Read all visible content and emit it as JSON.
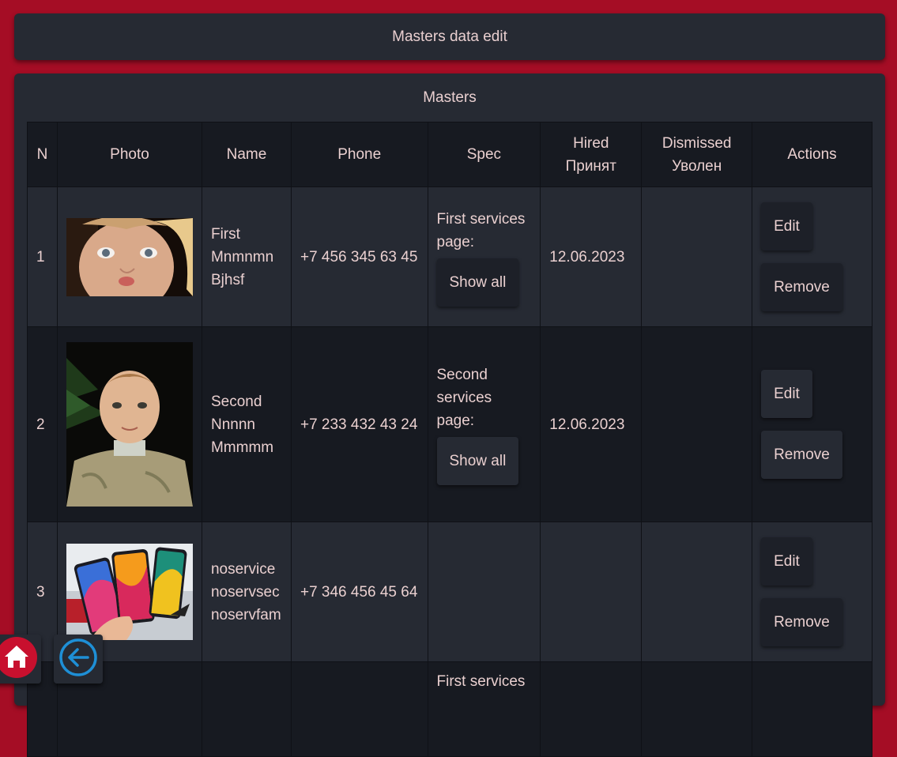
{
  "header": {
    "title": "Masters data edit"
  },
  "section": {
    "title": "Masters"
  },
  "table": {
    "columns": {
      "n": "N",
      "photo": "Photo",
      "name": "Name",
      "phone": "Phone",
      "spec": "Spec",
      "hired_en": "Hired",
      "hired_ru": "Принят",
      "dismissed_en": "Dismissed",
      "dismissed_ru": "Уволен",
      "actions": "Actions"
    },
    "rows": [
      {
        "n": "1",
        "name": [
          "First",
          "Mnmnmn",
          "Bjhsf"
        ],
        "phone": "+7 456 345 63 45",
        "spec_text": [
          "First services",
          "page:"
        ],
        "show_all": "Show all",
        "hired": "12.06.2023",
        "dismissed": "",
        "edit": "Edit",
        "remove": "Remove"
      },
      {
        "n": "2",
        "name": [
          "Second",
          "Nnnnn",
          "Mmmmm"
        ],
        "phone": "+7 233 432 43 24",
        "spec_text": [
          "Second",
          "services",
          "page:"
        ],
        "show_all": "Show all",
        "hired": "12.06.2023",
        "dismissed": "",
        "edit": "Edit",
        "remove": "Remove"
      },
      {
        "n": "3",
        "name": [
          "noservice",
          "noservsec",
          "noservfam"
        ],
        "phone": "+7 346 456 45 64",
        "edit": "Edit",
        "remove": "Remove"
      },
      {
        "spec_text": [
          "First services"
        ]
      }
    ]
  },
  "colors": {
    "background": "#a50d25",
    "card": "#262a33",
    "row_dark": "#171a21",
    "home_icon": "#c8102e",
    "back_icon": "#1e8fd6"
  },
  "icons": {
    "home": "home-icon",
    "back": "arrow-left-circle-icon"
  }
}
